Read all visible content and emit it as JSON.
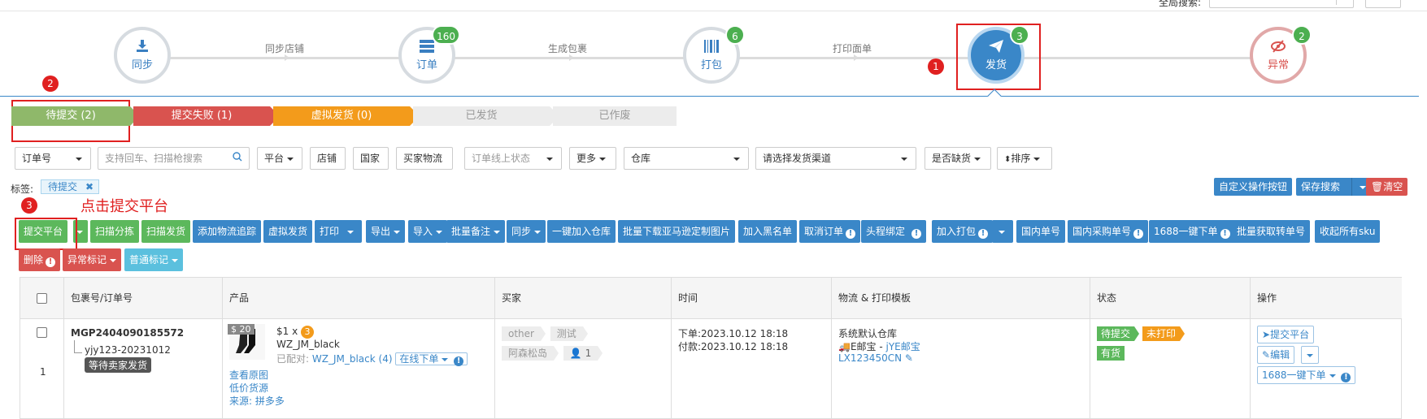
{
  "top": {
    "search_label": "全局搜索:"
  },
  "flow": {
    "nodes": [
      {
        "key": "sync",
        "label": "同步",
        "count": ""
      },
      {
        "key": "order",
        "label": "订单",
        "count": "160"
      },
      {
        "key": "pack",
        "label": "打包",
        "count": "6"
      },
      {
        "key": "ship",
        "label": "发货",
        "count": "3"
      },
      {
        "key": "abnormal",
        "label": "异常",
        "count": "2"
      }
    ],
    "steps": [
      "同步店铺",
      "生成包裹",
      "打印面单"
    ],
    "annotations": [
      "1",
      "2",
      "3"
    ]
  },
  "status_tabs": [
    {
      "label": "待提交 (2)",
      "color": "#8fb86a"
    },
    {
      "label": "提交失败 (1)",
      "color": "#d9534f"
    },
    {
      "label": "虚拟发货 (0)",
      "color": "#f39b1b"
    },
    {
      "label": "已发货",
      "color": "#ececec"
    },
    {
      "label": "已作废",
      "color": "#ececec"
    }
  ],
  "filters": {
    "order_no": "订单号",
    "search_placeholder": "支持回车、扫描枪搜索",
    "platform": "平台",
    "store": "店铺",
    "country": "国家",
    "buyer_logistics": "买家物流",
    "online_status": "订单线上状态",
    "more": "更多",
    "warehouse": "仓库",
    "channel": "请选择发货渠道",
    "out_of_stock": "是否缺货",
    "sort": "排序"
  },
  "tags": {
    "label": "标签:",
    "chip": "待提交",
    "chip_close": "✖"
  },
  "right_buttons": {
    "custom": "自定义操作按钮",
    "save_search": "保存搜索",
    "clear": "清空"
  },
  "callout": "点击提交平台",
  "actions": [
    {
      "label": "提交平台",
      "color": "green",
      "caret": false
    },
    {
      "label": "扫描分拣",
      "color": "green",
      "caret": false
    },
    {
      "label": "扫描发货",
      "color": "green",
      "caret": false
    },
    {
      "label": "添加物流追踪",
      "color": "blue",
      "caret": false
    },
    {
      "label": "虚拟发货",
      "color": "blue",
      "caret": false
    },
    {
      "label": "打印",
      "color": "blue",
      "caret": false
    },
    {
      "label": "导出",
      "color": "blue",
      "caret": true
    },
    {
      "label": "导入",
      "color": "blue",
      "caret": true
    },
    {
      "label": "批量备注",
      "color": "blue",
      "caret": true
    },
    {
      "label": "同步",
      "color": "blue",
      "caret": true
    },
    {
      "label": "一键加入仓库",
      "color": "blue",
      "caret": false
    },
    {
      "label": "批量下载亚马逊定制图片",
      "color": "blue",
      "caret": false
    },
    {
      "label": "加入黑名单",
      "color": "blue",
      "caret": false
    },
    {
      "label": "取消订单",
      "color": "blue",
      "caret": false
    },
    {
      "label": "头程绑定",
      "color": "blue",
      "caret": false
    },
    {
      "label": "加入打包",
      "color": "blue",
      "caret": false
    },
    {
      "label": "国内单号",
      "color": "blue",
      "caret": false
    },
    {
      "label": "国内采购单号",
      "color": "blue",
      "caret": false
    },
    {
      "label": "1688一键下单",
      "color": "blue",
      "caret": false
    },
    {
      "label": "批量获取转单号",
      "color": "blue",
      "caret": false
    },
    {
      "label": "收起所有sku",
      "color": "blue",
      "caret": false
    },
    {
      "label": "删除",
      "color": "red",
      "caret": false
    },
    {
      "label": "异常标记",
      "color": "red",
      "caret": true
    },
    {
      "label": "普通标记",
      "color": "lightblue",
      "caret": true
    }
  ],
  "table": {
    "headers": [
      "包裹号/订单号",
      "产品",
      "买家",
      "时间",
      "物流 & 打印模板",
      "状态",
      "操作"
    ],
    "row": {
      "index": "1",
      "package_no": "MGP2404090185572",
      "order_no": "yjy123-20231012",
      "tooltip": "等待卖家发货",
      "price_tag": "$ 20",
      "qty": "$1 x",
      "qty_badge": "3",
      "sku": "WZ_JM_black",
      "matched_label": "已配对:",
      "matched_sku": "WZ_JM_black (4)",
      "online_order": "在线下单",
      "view_image": "查看原图",
      "low_price": "低价货源",
      "source": "来源: 拼多多",
      "buyer_tags": [
        "other",
        "测试"
      ],
      "buyer_name": "阿森松岛",
      "buyer_count": "1",
      "order_time": "下单:2023.10.12 18:18",
      "pay_time": "付款:2023.10.12 18:18",
      "warehouse": "系统默认仓库",
      "carrier": "E邮宝 - ",
      "carrier_link": "jYE邮宝",
      "tracking": "LX123450CN",
      "status_pending": "待提交",
      "status_unprinted": "未打印",
      "status_stock": "有货",
      "op_submit": "提交平台",
      "op_edit": "编辑",
      "op_1688": "1688一键下单"
    }
  }
}
